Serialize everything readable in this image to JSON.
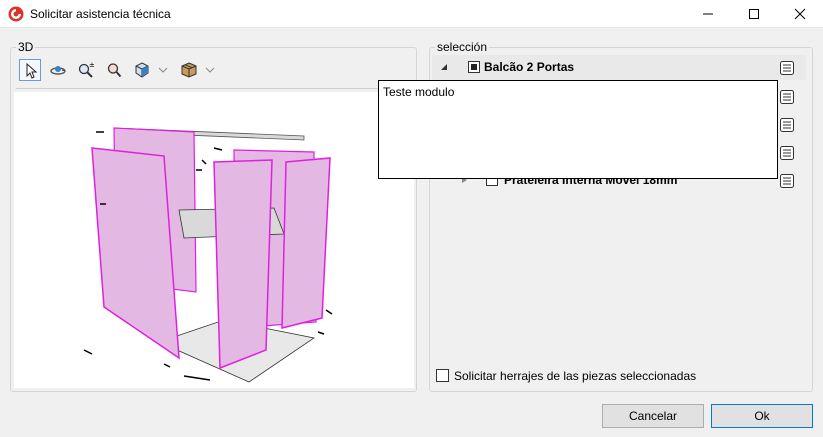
{
  "window": {
    "title": "Solicitar asistencia técnica",
    "accent_color": "#d9342b"
  },
  "panel_3d": {
    "label": "3D",
    "toolbar": [
      {
        "name": "select-tool",
        "icon": "cursor-arrow-icon",
        "active": true
      },
      {
        "name": "orbit-tool",
        "icon": "orbit-icon",
        "active": false
      },
      {
        "name": "zoom-tool",
        "icon": "zoom-plus-minus-icon",
        "active": false
      },
      {
        "name": "zoom-window-tool",
        "icon": "zoom-window-icon",
        "active": false
      },
      {
        "name": "view-cube-tool",
        "icon": "view-cube-icon",
        "active": false,
        "dropdown": true
      },
      {
        "name": "render-mode-tool",
        "icon": "box-render-icon",
        "active": false,
        "dropdown": true
      }
    ],
    "model_colors": {
      "panel_fill": "#e3b8e3",
      "panel_edge": "#e020e0",
      "shelf": "#d9d9d9"
    }
  },
  "panel_selection": {
    "label": "selección",
    "tree": [
      {
        "label": "Balcão 2 Portas",
        "checked": true,
        "expanded": true,
        "selected": true
      },
      {
        "label": "Prateleira Interna Movel 18mm",
        "checked": false,
        "expanded": false,
        "selected": false
      }
    ],
    "tooltip_text": "Teste modulo",
    "request_hardware_label": "Solicitar herrajes de las piezas seleccionadas",
    "request_hardware_checked": false
  },
  "buttons": {
    "cancel": "Cancelar",
    "ok": "Ok"
  }
}
